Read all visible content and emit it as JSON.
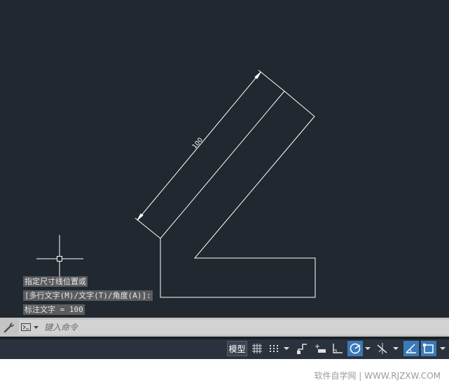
{
  "drawing": {
    "dimension_text": "100"
  },
  "command_history": [
    "指定尺寸线位置或",
    "[多行文字(M)/文字(T)/角度(A)]:",
    "标注文字 = 100"
  ],
  "command_line": {
    "placeholder": "键入命令"
  },
  "status_bar": {
    "model_tab_label": "模型"
  },
  "watermark": "软件自学网 | WWW.RJZXW.COM",
  "colors": {
    "canvas_bg": "#212830",
    "geometry": "#ffffff",
    "active_toggle": "#3a7ab8"
  }
}
